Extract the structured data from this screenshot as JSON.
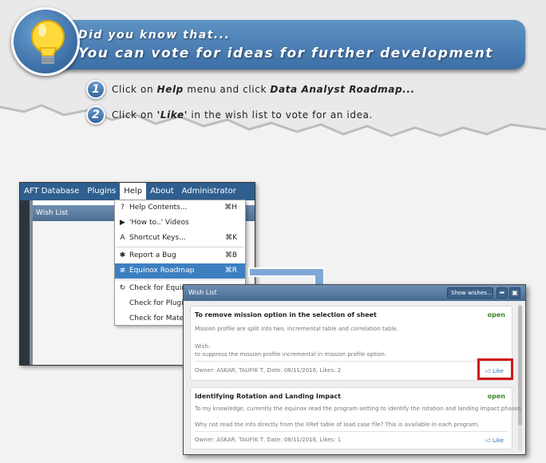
{
  "tip": {
    "line1": "Did you know that...",
    "line2": "You can vote for ideas for further development",
    "steps": [
      {
        "num": "1",
        "pre": "Click on ",
        "b1": "Help",
        "mid": " menu and click ",
        "b2": "Data Analyst Roadmap...",
        "post": ""
      },
      {
        "num": "2",
        "pre": "Click on ",
        "b1": "'Like'",
        "mid": " in the wish list to vote for an idea.",
        "b2": "",
        "post": ""
      }
    ]
  },
  "app": {
    "menubar": [
      "AFT Database",
      "Plugins",
      "Help",
      "About",
      "Administrator"
    ],
    "panel_title": "Wish List",
    "help_menu": [
      {
        "icon": "?",
        "label": "Help Contents...",
        "shortcut": "⌘H"
      },
      {
        "icon": "▶",
        "label": "'How to..' Videos",
        "shortcut": ""
      },
      {
        "icon": "A",
        "label": "Shortcut Keys...",
        "shortcut": "⌘K"
      },
      {
        "icon": "✱",
        "label": "Report a Bug",
        "shortcut": "⌘B"
      },
      {
        "icon": "≢",
        "label": "Equinox Roadmap",
        "shortcut": "⌘R"
      },
      {
        "icon": "↻",
        "label": "Check for Equin",
        "shortcut": ""
      },
      {
        "icon": "",
        "label": "Check for Plugin",
        "shortcut": ""
      },
      {
        "icon": "",
        "label": "Check for Mater",
        "shortcut": ""
      }
    ]
  },
  "wishlist": {
    "title": "Wish List",
    "show_label": "Show wishes...",
    "items": [
      {
        "title": "To remove mission option in the selection of sheet",
        "status": "open",
        "lines": [
          "Mission profile are split into two, incremental table and correlation table.",
          "Wish:",
          "to suppress the mission profile incremental in mission profile option."
        ],
        "meta": "Owner: ASKAR, TAUFIK T, Date: 08/11/2016, Likes: 2",
        "like": "Like"
      },
      {
        "title": "Identifying Rotation and Landing Impact",
        "status": "open",
        "lines": [
          "To my knowledge, currently the equinox read the program setting to identify the rotation and landing impact phases.",
          "Why not read the info directly from the XRef table of load case file? This is available in each program."
        ],
        "meta": "Owner: ASKAR, TAUFIK T, Date: 08/11/2016, Likes: 1",
        "like": "Like"
      }
    ]
  },
  "colors": {
    "accent": "#3c7fc1",
    "banner": "#4a7db3",
    "status_open": "#3a8a22",
    "highlight_box": "#d01818"
  }
}
